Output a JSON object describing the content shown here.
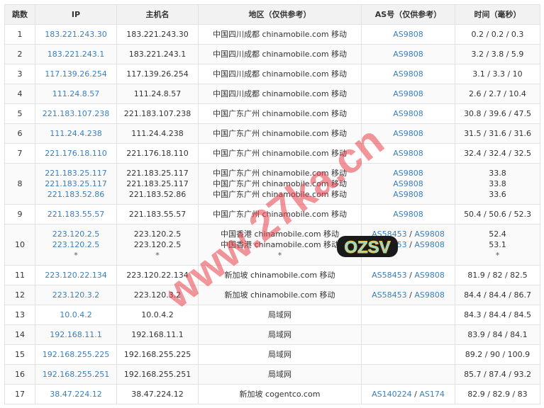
{
  "headers": [
    "跳数",
    "IP",
    "主机名",
    "地区（仅供参考）",
    "AS号（仅供参考）",
    "时间（毫秒）"
  ],
  "rows": [
    {
      "hop": "1",
      "ips": [
        "183.221.243.30"
      ],
      "hosts": [
        "183.221.243.30"
      ],
      "regions": [
        "中国四川成都 chinamobile.com 移动"
      ],
      "as": [
        [
          "AS9808"
        ]
      ],
      "times": [
        "0.2 / 0.2 / 0.3"
      ]
    },
    {
      "hop": "2",
      "ips": [
        "183.221.243.1"
      ],
      "hosts": [
        "183.221.243.1"
      ],
      "regions": [
        "中国四川成都 chinamobile.com 移动"
      ],
      "as": [
        [
          "AS9808"
        ]
      ],
      "times": [
        "3.2 / 3.8 / 5.9"
      ]
    },
    {
      "hop": "3",
      "ips": [
        "117.139.26.254"
      ],
      "hosts": [
        "117.139.26.254"
      ],
      "regions": [
        "中国四川成都 chinamobile.com 移动"
      ],
      "as": [
        [
          "AS9808"
        ]
      ],
      "times": [
        "3.1 / 3.3 / 10"
      ]
    },
    {
      "hop": "4",
      "ips": [
        "111.24.8.57"
      ],
      "hosts": [
        "111.24.8.57"
      ],
      "regions": [
        "中国四川成都 chinamobile.com 移动"
      ],
      "as": [
        [
          "AS9808"
        ]
      ],
      "times": [
        "2.6 / 2.7 / 10.4"
      ]
    },
    {
      "hop": "5",
      "ips": [
        "221.183.107.238"
      ],
      "hosts": [
        "221.183.107.238"
      ],
      "regions": [
        "中国广东广州 chinamobile.com 移动"
      ],
      "as": [
        [
          "AS9808"
        ]
      ],
      "times": [
        "30.8 / 39.6 / 47.5"
      ]
    },
    {
      "hop": "6",
      "ips": [
        "111.24.4.238"
      ],
      "hosts": [
        "111.24.4.238"
      ],
      "regions": [
        "中国广东广州 chinamobile.com 移动"
      ],
      "as": [
        [
          "AS9808"
        ]
      ],
      "times": [
        "31.5 / 31.6 / 31.6"
      ]
    },
    {
      "hop": "7",
      "ips": [
        "221.176.18.110"
      ],
      "hosts": [
        "221.176.18.110"
      ],
      "regions": [
        "中国广东广州 chinamobile.com 移动"
      ],
      "as": [
        [
          "AS9808"
        ]
      ],
      "times": [
        "32.4 / 32.4 / 32.5"
      ]
    },
    {
      "hop": "8",
      "ips": [
        "221.183.25.117",
        "221.183.25.117",
        "221.183.52.86"
      ],
      "hosts": [
        "221.183.25.117",
        "221.183.25.117",
        "221.183.52.86"
      ],
      "regions": [
        "中国广东广州 chinamobile.com 移动",
        "中国广东广州 chinamobile.com 移动",
        "中国广东广州 chinamobile.com 移动"
      ],
      "as": [
        [
          "AS9808"
        ],
        [
          "AS9808"
        ],
        [
          "AS9808"
        ]
      ],
      "times": [
        "33.8",
        "33.8",
        "33.6"
      ]
    },
    {
      "hop": "9",
      "ips": [
        "221.183.55.57"
      ],
      "hosts": [
        "221.183.55.57"
      ],
      "regions": [
        "中国广东广州 chinamobile.com 移动"
      ],
      "as": [
        [
          "AS9808"
        ]
      ],
      "times": [
        "50.4 / 50.6 / 52.3"
      ]
    },
    {
      "hop": "10",
      "ips": [
        "223.120.2.5",
        "223.120.2.5",
        "*"
      ],
      "hosts": [
        "223.120.2.5",
        "223.120.2.5",
        "*"
      ],
      "regions": [
        "中国香港 chinamobile.com 移动",
        "中国香港 chinamobile.com 移动",
        "*"
      ],
      "as": [
        [
          "AS58453",
          "AS9808"
        ],
        [
          "AS58453",
          "AS9808"
        ],
        []
      ],
      "times": [
        "52.4",
        "53.1",
        "*"
      ]
    },
    {
      "hop": "11",
      "ips": [
        "223.120.22.134"
      ],
      "hosts": [
        "223.120.22.134"
      ],
      "regions": [
        "新加坡 chinamobile.com 移动"
      ],
      "as": [
        [
          "AS58453",
          "AS9808"
        ]
      ],
      "times": [
        "81.9 / 82 / 82.5"
      ]
    },
    {
      "hop": "12",
      "ips": [
        "223.120.3.2"
      ],
      "hosts": [
        "223.120.3.2"
      ],
      "regions": [
        "新加坡 chinamobile.com 移动"
      ],
      "as": [
        [
          "AS58453",
          "AS9808"
        ]
      ],
      "times": [
        "84.4 / 84.4 / 86.7"
      ]
    },
    {
      "hop": "13",
      "ips": [
        "10.0.4.2"
      ],
      "hosts": [
        "10.0.4.2"
      ],
      "regions": [
        "局域网"
      ],
      "as": [
        []
      ],
      "times": [
        "84.3 / 84.4 / 84.5"
      ]
    },
    {
      "hop": "14",
      "ips": [
        "192.168.11.1"
      ],
      "hosts": [
        "192.168.11.1"
      ],
      "regions": [
        "局域网"
      ],
      "as": [
        []
      ],
      "times": [
        "83.9 / 84 / 84.1"
      ]
    },
    {
      "hop": "15",
      "ips": [
        "192.168.255.225"
      ],
      "hosts": [
        "192.168.255.225"
      ],
      "regions": [
        "局域网"
      ],
      "as": [
        []
      ],
      "times": [
        "89.2 / 90 / 100.9"
      ]
    },
    {
      "hop": "16",
      "ips": [
        "192.168.255.251"
      ],
      "hosts": [
        "192.168.255.251"
      ],
      "regions": [
        "局域网"
      ],
      "as": [
        []
      ],
      "times": [
        "85.7 / 87.4 / 93.2"
      ]
    },
    {
      "hop": "17",
      "ips": [
        "38.47.224.12"
      ],
      "hosts": [
        "38.47.224.12"
      ],
      "regions": [
        "新加坡 cogentco.com"
      ],
      "as": [
        [
          "AS140224",
          "AS174"
        ]
      ],
      "times": [
        "82.9 / 82.9 / 83"
      ]
    }
  ],
  "as_separator": " / ",
  "watermark": "www.27ka.cn",
  "badge": "OZSV",
  "colors": {
    "link": "#3a7fbf",
    "header_bg": "#f2f2f2",
    "border": "#e2e2e2",
    "watermark": "#e8404a"
  }
}
